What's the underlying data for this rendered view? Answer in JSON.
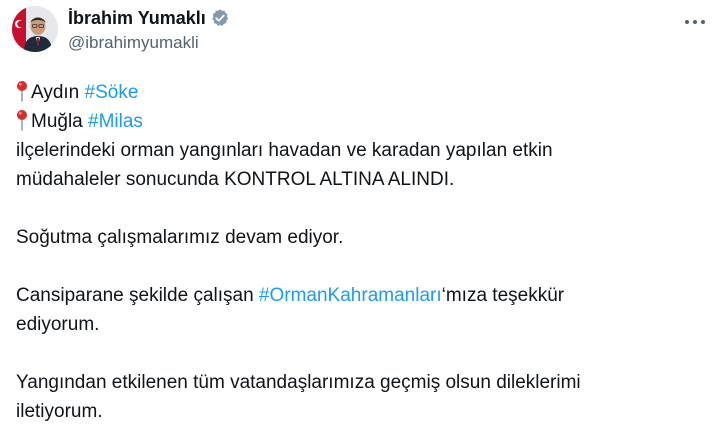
{
  "author": {
    "display_name": "İbrahim Yumaklı",
    "handle": "@ibrahimyumakli"
  },
  "icons": {
    "verified": "verified-badge-icon",
    "pin": "round-pushpin-icon",
    "more": "more-options-icon",
    "accent_color": "#1d9bf0",
    "verified_color": "#829aab"
  },
  "tweet": {
    "line1_place": "Aydın ",
    "line1_hashtag": "#Söke",
    "line2_place": "Muğla ",
    "line2_hashtag": "#Milas",
    "line3": "ilçelerindeki orman yangınları havadan ve karadan yapılan etkin",
    "line4": "müdahaleler sonucunda KONTROL ALTINA ALINDI.",
    "para2": "Soğutma çalışmalarımız devam ediyor.",
    "para3_before": "Cansiparane şekilde çalışan ",
    "para3_hashtag": "#OrmanKahramanları",
    "para3_after": "‘mıza teşekkür",
    "para3_line2": "ediyorum.",
    "para4_line1": "Yangından etkilenen tüm vatandaşlarımıza geçmiş olsun dileklerimi",
    "para4_line2": "iletiyorum."
  }
}
